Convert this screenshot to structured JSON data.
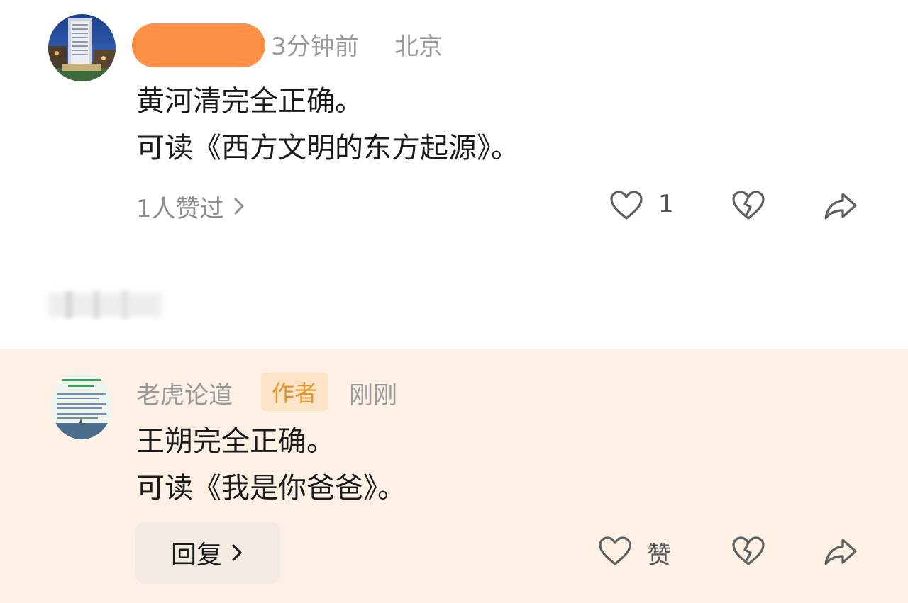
{
  "comment": {
    "username_redacted": true,
    "time": "3分钟前",
    "location": "北京",
    "lines": [
      "黄河清完全正确。",
      "可读《西方文明的东方起源》。"
    ],
    "likes_summary": "1人赞过",
    "like_count": "1"
  },
  "reply": {
    "author": "老虎论道",
    "author_badge": "作者",
    "time": "刚刚",
    "lines": [
      "王朔完全正确。",
      "可读《我是你爸爸》。"
    ],
    "reply_button_label": "回复",
    "like_label": "赞"
  },
  "colors": {
    "redaction_orange": "#ff8f45",
    "reply_background": "#fdf1e6",
    "author_badge_bg": "#fde4c7",
    "author_badge_text": "#e0962d",
    "reply_button_bg": "#f3ebe1"
  },
  "icons": [
    "heart-outline-icon",
    "broken-heart-icon",
    "share-arrow-icon",
    "chevron-right-icon"
  ]
}
